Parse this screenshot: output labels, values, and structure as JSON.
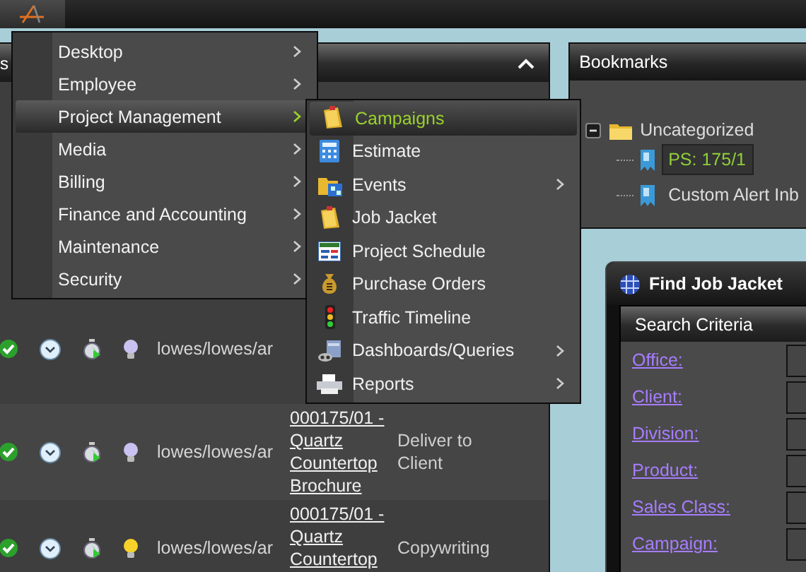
{
  "main_panel": {
    "header_text": "s"
  },
  "rows": [
    {
      "approved": true,
      "user": "lowes/lowes/ar",
      "bulb_on": false
    },
    {
      "approved": true,
      "user": "lowes/lowes/ar",
      "bulb_on": false,
      "job": "000175/01 - Quartz Countertop Brochure",
      "task": "Deliver to Client"
    },
    {
      "approved": true,
      "user": "lowes/lowes/ar",
      "bulb_on": true,
      "job": "000175/01 - Quartz Countertop",
      "task": "Copywriting"
    }
  ],
  "menu": {
    "items": [
      {
        "label": "Desktop",
        "selected": false,
        "has_submenu": true
      },
      {
        "label": "Employee",
        "selected": false,
        "has_submenu": true
      },
      {
        "label": "Project Management",
        "selected": true,
        "has_submenu": true
      },
      {
        "label": "Media",
        "selected": false,
        "has_submenu": true
      },
      {
        "label": "Billing",
        "selected": false,
        "has_submenu": true
      },
      {
        "label": "Finance and Accounting",
        "selected": false,
        "has_submenu": true
      },
      {
        "label": "Maintenance",
        "selected": false,
        "has_submenu": true
      },
      {
        "label": "Security",
        "selected": false,
        "has_submenu": true
      }
    ]
  },
  "submenu": {
    "items": [
      {
        "label": "Campaigns",
        "kind": "jacket",
        "selected": true,
        "has_submenu": false
      },
      {
        "label": "Estimate",
        "kind": "calculator",
        "selected": false,
        "has_submenu": false
      },
      {
        "label": "Events",
        "kind": "events",
        "selected": false,
        "has_submenu": true
      },
      {
        "label": "Job Jacket",
        "kind": "jacket",
        "selected": false,
        "has_submenu": false
      },
      {
        "label": "Project Schedule",
        "kind": "schedule",
        "selected": false,
        "has_submenu": false
      },
      {
        "label": "Purchase Orders",
        "kind": "moneybag",
        "selected": false,
        "has_submenu": false
      },
      {
        "label": "Traffic Timeline",
        "kind": "traffic",
        "selected": false,
        "has_submenu": false
      },
      {
        "label": "Dashboards/Queries",
        "kind": "dashboard",
        "selected": false,
        "has_submenu": true
      },
      {
        "label": "Reports",
        "kind": "printer",
        "selected": false,
        "has_submenu": true
      }
    ]
  },
  "bookmarks": {
    "title": "Bookmarks",
    "folders": [
      {
        "label": "Uncategorized",
        "expanded": true,
        "children": [
          {
            "label": "PS: 175/1",
            "selected": true
          },
          {
            "label": "Custom Alert Inb",
            "selected": false
          }
        ]
      }
    ]
  },
  "find_window": {
    "title": "Find Job Jacket",
    "section": "Search Criteria",
    "fields": [
      "Office:",
      "Client:",
      "Division:",
      "Product:",
      "Sales Class:",
      "Campaign:"
    ]
  }
}
